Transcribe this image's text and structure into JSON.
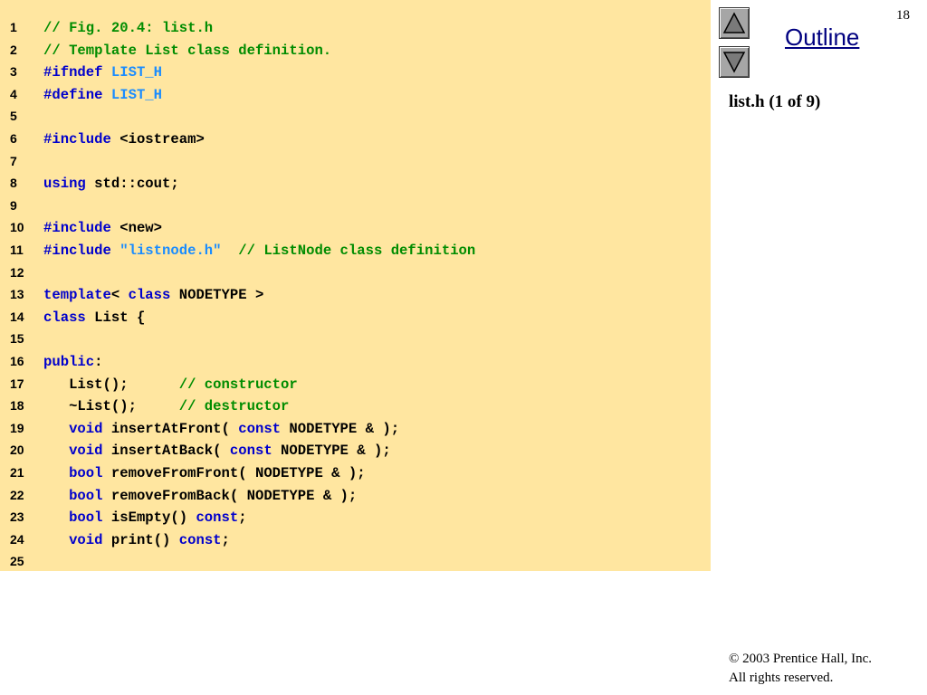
{
  "slide": {
    "page_number": "18",
    "outline_link": "Outline",
    "subtitle": "list.h (1 of 9)",
    "copyright_line1": "© 2003 Prentice Hall, Inc.",
    "copyright_line2": "All rights reserved.",
    "nav": {
      "up_icon": "triangle-up-icon",
      "down_icon": "triangle-down-icon"
    }
  },
  "colors": {
    "code_background": "#ffe6a0",
    "comment": "#008c00",
    "keyword": "#0000cc",
    "macro_string": "#1a8cff",
    "outline_link": "#000080"
  },
  "code": {
    "lines": [
      {
        "number": "1",
        "tokens": [
          {
            "text": "// Fig. 20.4: list.h",
            "type": "comment"
          }
        ]
      },
      {
        "number": "2",
        "tokens": [
          {
            "text": "// Template List class definition.",
            "type": "comment"
          }
        ]
      },
      {
        "number": "3",
        "tokens": [
          {
            "text": "#ifndef",
            "type": "keyword"
          },
          {
            "text": " ",
            "type": "plain"
          },
          {
            "text": "LIST_H",
            "type": "macro"
          }
        ]
      },
      {
        "number": "4",
        "tokens": [
          {
            "text": "#define",
            "type": "keyword"
          },
          {
            "text": " ",
            "type": "plain"
          },
          {
            "text": "LIST_H",
            "type": "macro"
          }
        ]
      },
      {
        "number": "5",
        "tokens": []
      },
      {
        "number": "6",
        "tokens": [
          {
            "text": "#include",
            "type": "keyword"
          },
          {
            "text": " <iostream>",
            "type": "plain"
          }
        ]
      },
      {
        "number": "7",
        "tokens": []
      },
      {
        "number": "8",
        "tokens": [
          {
            "text": "using",
            "type": "keyword"
          },
          {
            "text": " std::cout;",
            "type": "plain"
          }
        ]
      },
      {
        "number": "9",
        "tokens": []
      },
      {
        "number": "10",
        "tokens": [
          {
            "text": "#include",
            "type": "keyword"
          },
          {
            "text": " <new>",
            "type": "plain"
          }
        ]
      },
      {
        "number": "11",
        "tokens": [
          {
            "text": "#include",
            "type": "keyword"
          },
          {
            "text": " ",
            "type": "plain"
          },
          {
            "text": "\"listnode.h\"",
            "type": "string"
          },
          {
            "text": "  ",
            "type": "plain"
          },
          {
            "text": "// ListNode class definition",
            "type": "comment"
          }
        ]
      },
      {
        "number": "12",
        "tokens": []
      },
      {
        "number": "13",
        "tokens": [
          {
            "text": "template",
            "type": "keyword"
          },
          {
            "text": "< ",
            "type": "plain"
          },
          {
            "text": "class",
            "type": "keyword"
          },
          {
            "text": " NODETYPE >",
            "type": "plain"
          }
        ]
      },
      {
        "number": "14",
        "tokens": [
          {
            "text": "class",
            "type": "keyword"
          },
          {
            "text": " List {",
            "type": "plain"
          }
        ]
      },
      {
        "number": "15",
        "tokens": []
      },
      {
        "number": "16",
        "tokens": [
          {
            "text": "public",
            "type": "keyword"
          },
          {
            "text": ":",
            "type": "plain"
          }
        ]
      },
      {
        "number": "17",
        "tokens": [
          {
            "text": "   List();      ",
            "type": "plain"
          },
          {
            "text": "// constructor",
            "type": "comment"
          }
        ]
      },
      {
        "number": "18",
        "tokens": [
          {
            "text": "   ~List();     ",
            "type": "plain"
          },
          {
            "text": "// destructor",
            "type": "comment"
          }
        ]
      },
      {
        "number": "19",
        "tokens": [
          {
            "text": "   ",
            "type": "plain"
          },
          {
            "text": "void",
            "type": "keyword"
          },
          {
            "text": " insertAtFront( ",
            "type": "plain"
          },
          {
            "text": "const",
            "type": "keyword"
          },
          {
            "text": " NODETYPE & );",
            "type": "plain"
          }
        ]
      },
      {
        "number": "20",
        "tokens": [
          {
            "text": "   ",
            "type": "plain"
          },
          {
            "text": "void",
            "type": "keyword"
          },
          {
            "text": " insertAtBack( ",
            "type": "plain"
          },
          {
            "text": "const",
            "type": "keyword"
          },
          {
            "text": " NODETYPE & );",
            "type": "plain"
          }
        ]
      },
      {
        "number": "21",
        "tokens": [
          {
            "text": "   ",
            "type": "plain"
          },
          {
            "text": "bool",
            "type": "keyword"
          },
          {
            "text": " removeFromFront( NODETYPE & );",
            "type": "plain"
          }
        ]
      },
      {
        "number": "22",
        "tokens": [
          {
            "text": "   ",
            "type": "plain"
          },
          {
            "text": "bool",
            "type": "keyword"
          },
          {
            "text": " removeFromBack( NODETYPE & );",
            "type": "plain"
          }
        ]
      },
      {
        "number": "23",
        "tokens": [
          {
            "text": "   ",
            "type": "plain"
          },
          {
            "text": "bool",
            "type": "keyword"
          },
          {
            "text": " isEmpty() ",
            "type": "plain"
          },
          {
            "text": "const",
            "type": "keyword"
          },
          {
            "text": ";",
            "type": "plain"
          }
        ]
      },
      {
        "number": "24",
        "tokens": [
          {
            "text": "   ",
            "type": "plain"
          },
          {
            "text": "void",
            "type": "keyword"
          },
          {
            "text": " print() ",
            "type": "plain"
          },
          {
            "text": "const",
            "type": "keyword"
          },
          {
            "text": ";",
            "type": "plain"
          }
        ]
      },
      {
        "number": "25",
        "tokens": []
      }
    ]
  }
}
